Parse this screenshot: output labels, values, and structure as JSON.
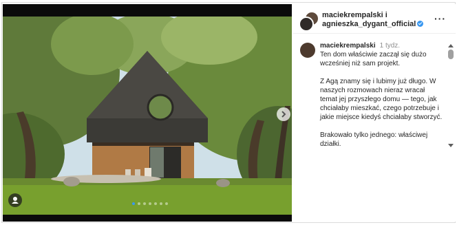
{
  "post": {
    "author_line1": "maciekrempalski i",
    "author_line2": "agnieszka_dygant_official",
    "more_label": "···"
  },
  "carousel": {
    "slide_count": 7,
    "active_index": 0
  },
  "comment": {
    "username": "maciekrempalski",
    "time": "1 tydz.",
    "p1": "Ten dom właściwie zaczął się dużo wcześniej niż sam projekt.",
    "p2": "Z Agą znamy się i lubimy już długo. W naszych rozmowach nieraz wracał temat jej przyszłego domu — tego, jak chciałaby mieszkać, czego potrzebuje i jakie miejsce kiedyś chciałaby stworzyć.",
    "p3": "Brakowało tylko jednego: właściwej działki."
  },
  "icons": {
    "verified": "verified-badge-icon",
    "user_tag": "user-tag-icon",
    "next": "chevron-right-icon",
    "scroll_up": "triangle-up-icon",
    "scroll_down": "triangle-down-icon"
  },
  "colors": {
    "accent": "#3897f0",
    "text": "#262626",
    "muted": "#8e8e8e"
  }
}
